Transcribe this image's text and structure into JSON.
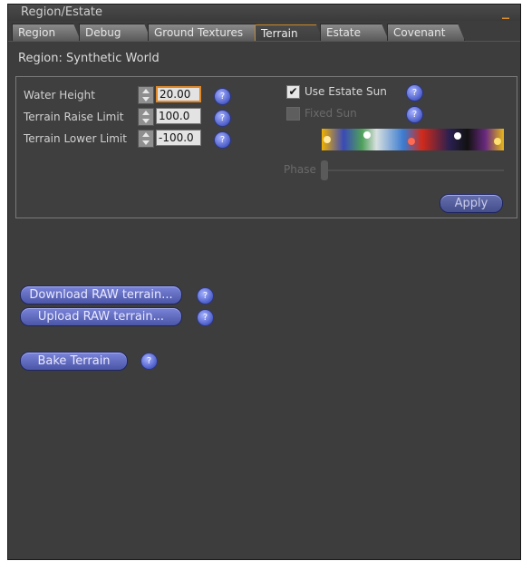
{
  "window": {
    "title": "Region/Estate",
    "minimize": "_"
  },
  "tabs": [
    {
      "label": "Region"
    },
    {
      "label": "Debug"
    },
    {
      "label": "Ground Textures"
    },
    {
      "label": "Terrain",
      "active": true
    },
    {
      "label": "Estate"
    },
    {
      "label": "Covenant"
    }
  ],
  "region": {
    "label": "Region:",
    "name": "Synthetic World"
  },
  "terrain": {
    "water_height": {
      "label": "Water Height",
      "value": "20.00"
    },
    "raise_limit": {
      "label": "Terrain Raise Limit",
      "value": "100.0"
    },
    "lower_limit": {
      "label": "Terrain Lower Limit",
      "value": "-100.0"
    }
  },
  "sun": {
    "use_estate_sun": {
      "label": "Use Estate Sun",
      "checked": true
    },
    "fixed_sun": {
      "label": "Fixed Sun",
      "checked": false,
      "enabled": false
    },
    "phase_label": "Phase"
  },
  "buttons": {
    "apply": "Apply",
    "download_raw": "Download RAW terrain...",
    "upload_raw": "Upload RAW terrain...",
    "bake": "Bake Terrain"
  },
  "help_glyph": "?",
  "check_glyph": "✔",
  "colors": {
    "accent": "#e08a2a",
    "button": "#5c66c0",
    "background": "#3d3d3d"
  }
}
